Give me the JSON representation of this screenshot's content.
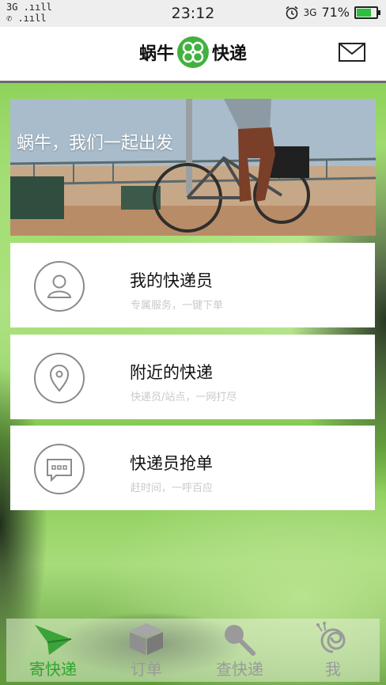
{
  "status_bar": {
    "time": "23:12",
    "network_top": "3G .ııll",
    "network_bottom": "✆ .ııll",
    "net_type": "3G",
    "battery": "71%",
    "battery_level": 0.71,
    "alarm_icon": "alarm-clock-icon"
  },
  "header": {
    "logo_left": "蜗牛",
    "logo_right": "快递",
    "mail_icon": "mail-icon"
  },
  "banner": {
    "text": "蜗牛，我们一起出发"
  },
  "cards": [
    {
      "title": "我的快递员",
      "subtitle": "专属服务，一键下单",
      "icon": "person-icon"
    },
    {
      "title": "附近的快递",
      "subtitle": "快递员/站点，一网打尽",
      "icon": "location-pin-icon"
    },
    {
      "title": "快递员抢单",
      "subtitle": "赶时间，一呼百应",
      "icon": "chat-bubble-icon"
    }
  ],
  "nav": [
    {
      "label": "寄快递",
      "icon": "paper-plane-icon",
      "active": true
    },
    {
      "label": "订单",
      "icon": "box-icon",
      "active": false
    },
    {
      "label": "查快递",
      "icon": "magnifier-icon",
      "active": false
    },
    {
      "label": "我",
      "icon": "snail-icon",
      "active": false
    }
  ],
  "colors": {
    "brand_green": "#43b140",
    "active_nav": "#2fa52e",
    "inactive_nav": "#9a9a9a"
  }
}
